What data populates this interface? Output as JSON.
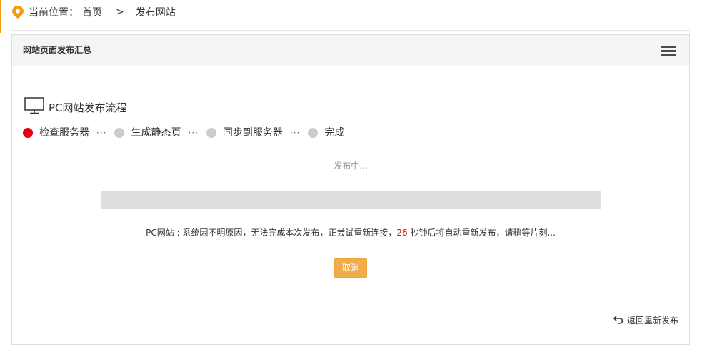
{
  "breadcrumb": {
    "icon": "location-pin-icon",
    "label": "当前位置：",
    "home": "首页",
    "separator": ">",
    "current": "发布网站"
  },
  "panel": {
    "title": "网站页面发布汇总",
    "menu_icon": "hamburger-menu-icon"
  },
  "flow": {
    "icon": "monitor-icon",
    "title": "PC网站发布流程",
    "step_separator": "···",
    "steps": [
      {
        "label": "检查服务器",
        "active": true
      },
      {
        "label": "生成静态页",
        "active": false
      },
      {
        "label": "同步到服务器",
        "active": false
      },
      {
        "label": "完成",
        "active": false
      }
    ]
  },
  "status": {
    "text": "发布中...",
    "progress": 0
  },
  "message": {
    "prefix": "PC网站 : 系统因不明原因，无法完成本次发布，正尝试重新连接，",
    "countdown": "26",
    "suffix": " 秒钟后将自动重新发布，请稍等片刻..."
  },
  "cancel_label": "取消",
  "back": {
    "icon": "undo-icon",
    "label": "返回重新发布"
  },
  "colors": {
    "accent": "#f39c12",
    "active_step": "#e60012",
    "pending_step": "#cccccc",
    "countdown": "#e60012",
    "button": "#f0ad4e",
    "button_border": "#eea236",
    "progress_track": "#dddddd"
  }
}
